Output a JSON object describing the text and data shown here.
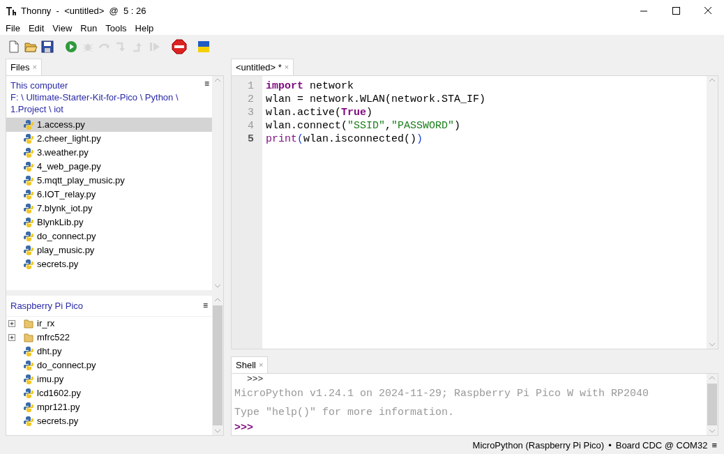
{
  "window": {
    "title": "Thonny  -  <untitled>  @  5 : 26"
  },
  "menu": [
    "File",
    "Edit",
    "View",
    "Run",
    "Tools",
    "Help"
  ],
  "toolbar": [
    {
      "kind": "new",
      "disabled": false
    },
    {
      "kind": "open",
      "disabled": false
    },
    {
      "kind": "save",
      "disabled": false
    },
    {
      "kind": "run",
      "disabled": false
    },
    {
      "kind": "debug",
      "disabled": true
    },
    {
      "kind": "step-over",
      "disabled": true
    },
    {
      "kind": "step-into",
      "disabled": true
    },
    {
      "kind": "step-out",
      "disabled": true
    },
    {
      "kind": "resume",
      "disabled": true
    },
    {
      "kind": "stop",
      "disabled": false
    },
    {
      "kind": "flag",
      "disabled": false
    }
  ],
  "files_tab": {
    "label": "Files",
    "close": "×"
  },
  "computer": {
    "title": "This computer",
    "menu": "≡",
    "path": "F: \\ Ultimate-Starter-Kit-for-Pico \\ Python \\ 1.Project \\ iot",
    "items": [
      {
        "name": "1.access.py",
        "selected": true
      },
      {
        "name": "2.cheer_light.py",
        "selected": false
      },
      {
        "name": "3.weather.py",
        "selected": false
      },
      {
        "name": "4_web_page.py",
        "selected": false
      },
      {
        "name": "5.mqtt_play_music.py",
        "selected": false
      },
      {
        "name": "6.IOT_relay.py",
        "selected": false
      },
      {
        "name": "7.blynk_iot.py",
        "selected": false
      },
      {
        "name": "BlynkLib.py",
        "selected": false
      },
      {
        "name": "do_connect.py",
        "selected": false
      },
      {
        "name": "play_music.py",
        "selected": false
      },
      {
        "name": "secrets.py",
        "selected": false
      }
    ]
  },
  "device": {
    "title": "Raspberry Pi Pico",
    "menu": "≡",
    "items": [
      {
        "kind": "folder",
        "name": "ir_rx",
        "expanded": false
      },
      {
        "kind": "folder",
        "name": "mfrc522",
        "expanded": false
      },
      {
        "kind": "file",
        "name": "dht.py"
      },
      {
        "kind": "file",
        "name": "do_connect.py"
      },
      {
        "kind": "file",
        "name": "imu.py"
      },
      {
        "kind": "file",
        "name": "lcd1602.py"
      },
      {
        "kind": "file",
        "name": "mpr121.py"
      },
      {
        "kind": "file",
        "name": "secrets.py"
      }
    ]
  },
  "editor_tab": {
    "label": "<untitled> *",
    "close": "×"
  },
  "editor": {
    "lines": [
      {
        "number": "1",
        "current": false,
        "tokens": [
          {
            "kind": "keyword",
            "text": "import"
          },
          {
            "kind": "text",
            "text": " network"
          }
        ]
      },
      {
        "number": "2",
        "current": false,
        "tokens": [
          {
            "kind": "text",
            "text": "wlan = network.WLAN(network.STA_IF)"
          }
        ]
      },
      {
        "number": "3",
        "current": false,
        "tokens": [
          {
            "kind": "text",
            "text": "wlan.active("
          },
          {
            "kind": "keyword",
            "text": "True"
          },
          {
            "kind": "text",
            "text": ")"
          }
        ]
      },
      {
        "number": "4",
        "current": false,
        "tokens": [
          {
            "kind": "text",
            "text": "wlan.connect("
          },
          {
            "kind": "string",
            "text": "\"SSID\""
          },
          {
            "kind": "text",
            "text": ","
          },
          {
            "kind": "string",
            "text": "\"PASSWORD\""
          },
          {
            "kind": "text",
            "text": ")"
          }
        ]
      },
      {
        "number": "5",
        "current": true,
        "tokens": [
          {
            "kind": "builtin",
            "text": "print"
          },
          {
            "kind": "bracket",
            "text": "("
          },
          {
            "kind": "text",
            "text": "wlan.isconnected()"
          },
          {
            "kind": "bracket",
            "text": ")"
          }
        ]
      }
    ]
  },
  "shell_tab": {
    "label": "Shell",
    "close": "×"
  },
  "shell": {
    "lines": [
      {
        "kind": "prompt-old",
        "text": ">>>"
      },
      {
        "kind": "info",
        "text": "MicroPython v1.24.1 on 2024-11-29; Raspberry Pi Pico W with RP2040"
      },
      {
        "kind": "info",
        "text": "Type \"help()\" for more information."
      },
      {
        "kind": "prompt",
        "text": ">>>"
      }
    ]
  },
  "status_bar": {
    "interpreter": "MicroPython (Raspberry Pi Pico)",
    "separator": "•",
    "port": "Board CDC @ COM32",
    "menu": "≡"
  }
}
